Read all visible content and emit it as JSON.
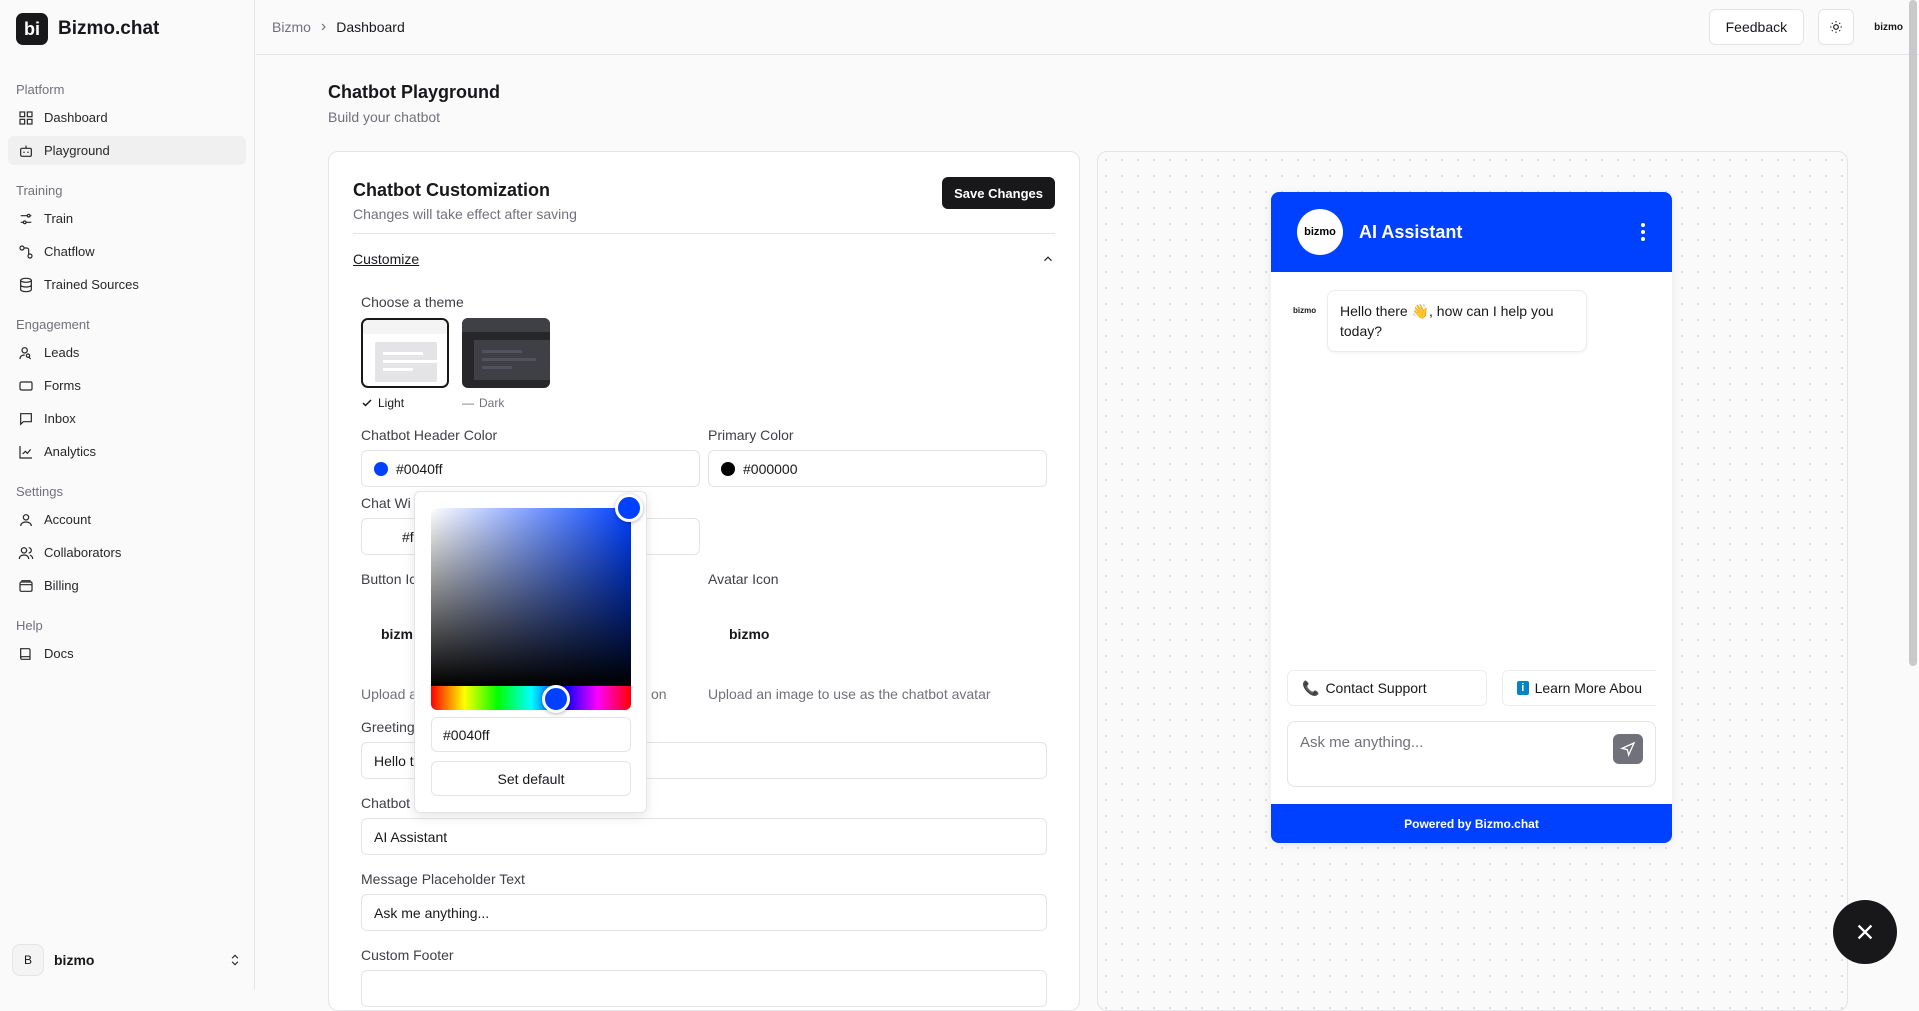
{
  "brand": {
    "name": "Bizmo.chat",
    "logo_text": "bi"
  },
  "sidebar": {
    "sections": [
      {
        "label": "Platform",
        "items": [
          {
            "label": "Dashboard",
            "icon": "grid-icon"
          },
          {
            "label": "Playground",
            "icon": "bot-icon"
          }
        ]
      },
      {
        "label": "Training",
        "items": [
          {
            "label": "Train",
            "icon": "sliders-icon"
          },
          {
            "label": "Chatflow",
            "icon": "flow-icon"
          },
          {
            "label": "Trained Sources",
            "icon": "database-icon"
          }
        ]
      },
      {
        "label": "Engagement",
        "items": [
          {
            "label": "Leads",
            "icon": "user-search-icon"
          },
          {
            "label": "Forms",
            "icon": "form-icon"
          },
          {
            "label": "Inbox",
            "icon": "message-icon"
          },
          {
            "label": "Analytics",
            "icon": "chart-icon"
          }
        ]
      },
      {
        "label": "Settings",
        "items": [
          {
            "label": "Account",
            "icon": "user-icon"
          },
          {
            "label": "Collaborators",
            "icon": "users-icon"
          },
          {
            "label": "Billing",
            "icon": "wallet-icon"
          }
        ]
      },
      {
        "label": "Help",
        "items": [
          {
            "label": "Docs",
            "icon": "book-icon"
          }
        ]
      }
    ],
    "user": {
      "initial": "B",
      "name": "bizmo"
    }
  },
  "topbar": {
    "crumb_root": "Bizmo",
    "crumb_current": "Dashboard",
    "feedback_label": "Feedback",
    "mini_logo": "bizmo"
  },
  "page": {
    "title": "Chatbot Playground",
    "subtitle": "Build your chatbot"
  },
  "customization": {
    "title": "Chatbot Customization",
    "subtitle": "Changes will take effect after saving",
    "save_label": "Save Changes",
    "accordion_label": "Customize",
    "theme_label": "Choose a theme",
    "theme_light": "Light",
    "theme_dark": "Dark",
    "header_color_label": "Chatbot Header Color",
    "header_color_value": "#0040ff",
    "primary_color_label": "Primary Color",
    "primary_color_value": "#000000",
    "chat_window_label_partial": "Chat Wi",
    "chat_window_value_partial": "#f",
    "button_icon_label_partial": "Button Ic",
    "button_icon_word_partial": "bizm",
    "avatar_icon_label": "Avatar Icon",
    "avatar_word": "bizmo",
    "upload_button_partial_left": "Upload a",
    "upload_button_partial_right": "on",
    "upload_avatar_helper": "Upload an image to use as the chatbot avatar",
    "greeting_label_partial": "Greeting",
    "greeting_value_partial": "Hello t",
    "chatbot_name_label_partial": "Chatbot",
    "chatbot_name_value": "AI Assistant",
    "placeholder_label": "Message Placeholder Text",
    "placeholder_value": "Ask me anything...",
    "footer_label": "Custom Footer",
    "colors": {
      "header": "#0040ff",
      "primary": "#000000"
    }
  },
  "picker": {
    "hex_value": "#0040ff",
    "set_default_label": "Set default"
  },
  "widget": {
    "logo_text": "bizmo",
    "title": "AI Assistant",
    "msg_avatar": "bizmo",
    "greeting": "Hello there 👋, how can I help you today?",
    "chip_1": "Contact Support",
    "chip_2": "Learn More Abou",
    "input_placeholder": "Ask me anything...",
    "footer": "Powered by Bizmo.chat"
  }
}
